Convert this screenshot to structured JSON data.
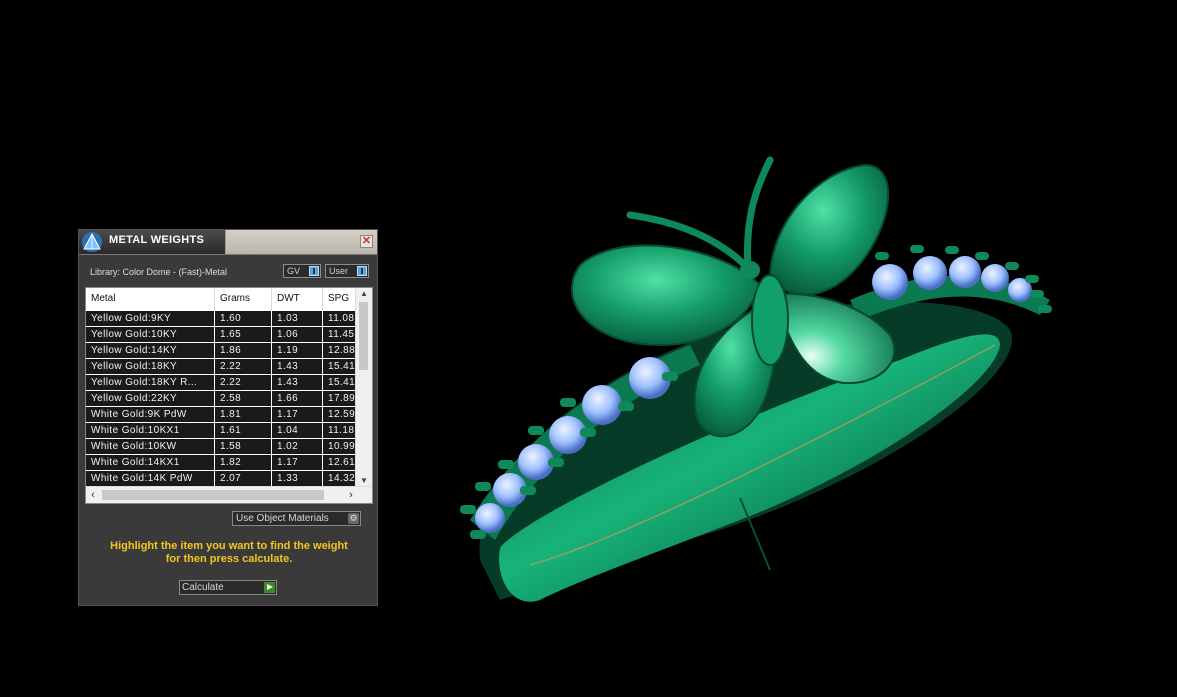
{
  "panel": {
    "title": "METAL WEIGHTS",
    "close_glyph": "✕",
    "library_label": "Library: Color Dome - (Fast)-Metal",
    "toggle_gv": "GV",
    "toggle_user": "User",
    "dropdown_value": "Use Object Materials",
    "hint_line1": "Highlight the item you want to find the weight",
    "hint_line2": "for then press calculate.",
    "calculate_label": "Calculate"
  },
  "table": {
    "columns": [
      "Metal",
      "Grams",
      "DWT",
      "SPG"
    ],
    "rows": [
      [
        "Yellow Gold:9KY",
        "1.60",
        "1.03",
        "11.08"
      ],
      [
        "Yellow Gold:10KY",
        "1.65",
        "1.06",
        "11.45"
      ],
      [
        "Yellow Gold:14KY",
        "1.86",
        "1.19",
        "12.88"
      ],
      [
        "Yellow Gold:18KY",
        "2.22",
        "1.43",
        "15.41"
      ],
      [
        "Yellow Gold:18KY R...",
        "2.22",
        "1.43",
        "15.41"
      ],
      [
        "Yellow Gold:22KY",
        "2.58",
        "1.66",
        "17.89"
      ],
      [
        "White Gold:9K PdW",
        "1.81",
        "1.17",
        "12.59"
      ],
      [
        "White Gold:10KX1",
        "1.61",
        "1.04",
        "11.18"
      ],
      [
        "White Gold:10KW",
        "1.58",
        "1.02",
        "10.99"
      ],
      [
        "White Gold:14KX1",
        "1.82",
        "1.17",
        "12.61"
      ],
      [
        "White Gold:14K PdW",
        "2.07",
        "1.33",
        "14.32"
      ]
    ]
  },
  "icons": {
    "app_icon": "pyramid-icon",
    "close": "close-icon",
    "settings": "gear-icon",
    "play": "play-icon"
  },
  "colors": {
    "ring_green": "#0c8a5c",
    "gem_blue": "#a8c8ff",
    "hint_yellow": "#f2c81e"
  }
}
